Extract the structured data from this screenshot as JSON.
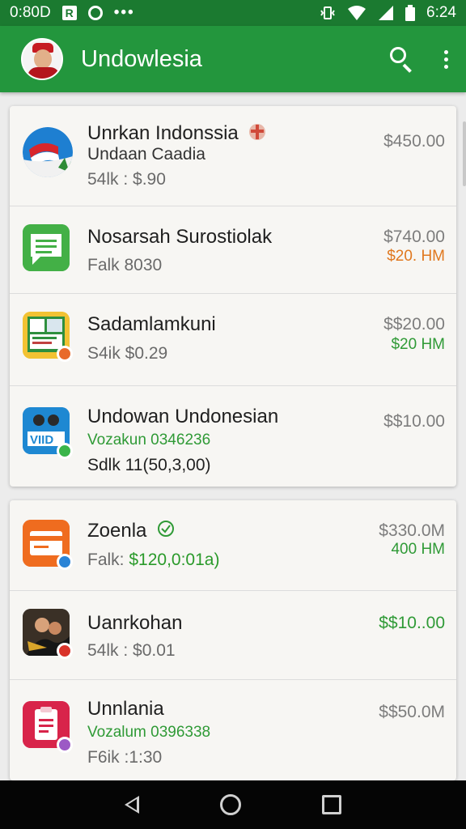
{
  "status_bar": {
    "time_left": "0:80D",
    "badge_letter": "R",
    "dots": "•••",
    "time_right": "6:24",
    "icons": [
      "badge-r-icon",
      "circle-status-icon",
      "more-dots-icon",
      "vibrate-icon",
      "wifi-icon",
      "signal-icon",
      "battery-icon"
    ]
  },
  "app_bar": {
    "title": "Undowlesia",
    "icons": [
      "avatar",
      "search-icon",
      "more-vert-icon"
    ]
  },
  "colors": {
    "app_bar": "#23963d",
    "status_bar": "#1b7a30",
    "accent_green": "#2f9a36",
    "accent_orange": "#e0781f"
  },
  "card1": {
    "items": [
      {
        "name": "Unrkan Indonssia",
        "line2": "Undaan Caadia",
        "meta": "54lk : $.90",
        "price": "$450.00",
        "sub": "",
        "icon": "flag-landscape-icon",
        "badge": "gift-badge-icon"
      },
      {
        "name": "Nosarsah Surostiolak",
        "meta": "Falk 8030",
        "price": "$740.00",
        "sub": "$20. HM",
        "icon": "chat-message-icon"
      },
      {
        "name": "Sadamlamkuni",
        "meta": "S4ik $0.29",
        "price": "$$20.00",
        "sub": "$20 HM",
        "icon": "photo-collage-icon"
      },
      {
        "name": "Undowan Undonesian",
        "line2": "Vozakun 0346236",
        "meta": "Sdlk 11(50,3,00)",
        "price": "$$10.00",
        "sub": "",
        "icon": "vid-people-icon"
      }
    ]
  },
  "card2": {
    "items": [
      {
        "name": "Zoenla",
        "meta_prefix": "Falk:",
        "meta_value": "$120,0:01a)",
        "price": "$330.0M",
        "sub": "400 HM",
        "icon": "wallet-card-icon",
        "badge": "check-badge-icon"
      },
      {
        "name": "Uanrkohan",
        "meta": "54lk : $0.01",
        "price": "$$10..00",
        "sub": "",
        "icon": "game-scene-icon"
      },
      {
        "name": "Unnlania",
        "line2": "Vozalum 0396338",
        "meta": "F6ik :1:30",
        "price": "$$50.0M",
        "sub": "",
        "icon": "clipboard-document-icon"
      }
    ]
  },
  "nav_bar": {
    "icons": [
      "back-icon",
      "home-icon",
      "recents-icon"
    ]
  }
}
